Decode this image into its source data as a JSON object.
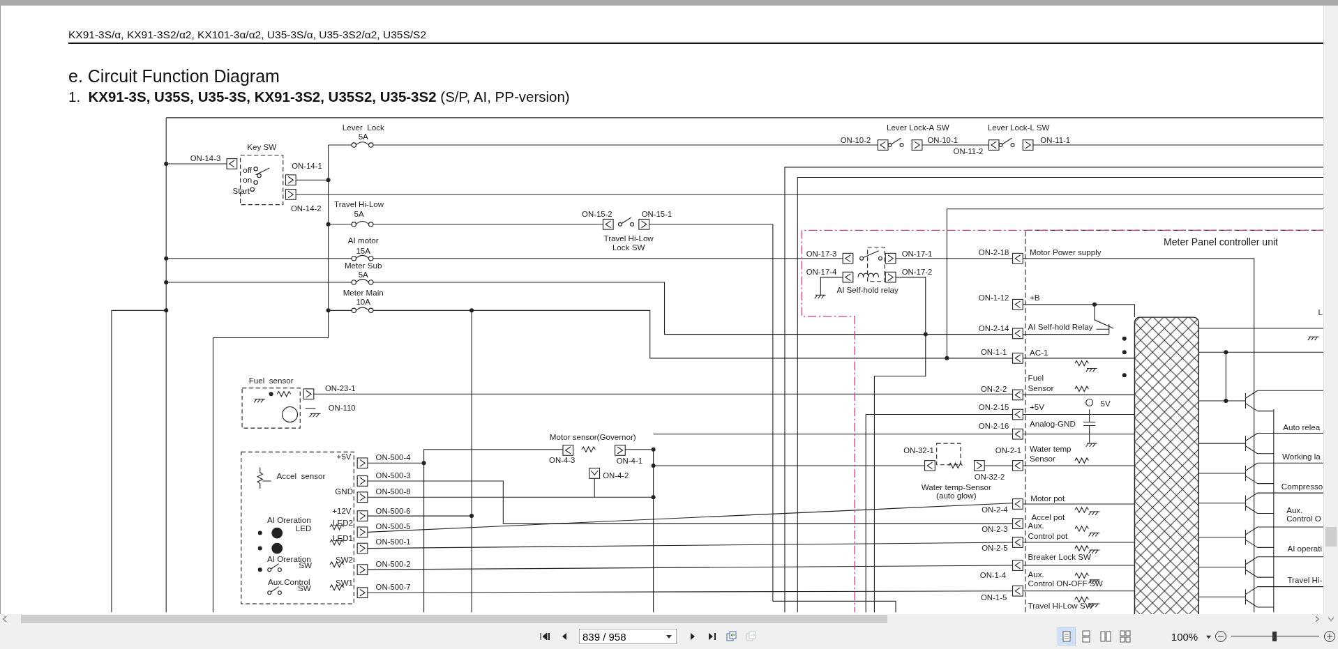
{
  "document": {
    "running_header": "KX91-3S/α, KX91-3S2/α2, KX101-3α/α2, U35-3S/α, U35-3S2/α2, U35S/S2",
    "section_title": "e. Circuit Function Diagram",
    "subtitle": "1.  **KX91-3S, U35S, U35-3S, KX91-3S2, U35S2, U35-3S2** (S/P, AI, PP-version)",
    "diagram": {
      "labels": [
        {
          "text": "Lever  Lock",
          "kind": "fuse"
        },
        {
          "text": "5A",
          "kind": "fuse"
        },
        {
          "text": "Key SW",
          "kind": "component"
        },
        {
          "text": "ON-14-3",
          "kind": "connector"
        },
        {
          "text": "off",
          "kind": "signal"
        },
        {
          "text": "on",
          "kind": "signal"
        },
        {
          "text": "Start",
          "kind": "signal"
        },
        {
          "text": "ON-14-1",
          "kind": "connector"
        },
        {
          "text": "ON-14-2",
          "kind": "connector"
        },
        {
          "text": "Travel Hi-Low",
          "kind": "fuse"
        },
        {
          "text": "5A",
          "kind": "fuse"
        },
        {
          "text": "AI motor",
          "kind": "fuse"
        },
        {
          "text": "15A",
          "kind": "fuse"
        },
        {
          "text": "Meter Sub",
          "kind": "fuse"
        },
        {
          "text": "5A",
          "kind": "fuse"
        },
        {
          "text": "Meter Main",
          "kind": "fuse"
        },
        {
          "text": "10A",
          "kind": "fuse"
        },
        {
          "text": "ON-15-2",
          "kind": "connector"
        },
        {
          "text": "ON-15-1",
          "kind": "connector"
        },
        {
          "text": "Travel Hi-Low",
          "kind": "component"
        },
        {
          "text": "Lock SW",
          "kind": "component"
        },
        {
          "text": "Lever Lock-A SW",
          "kind": "component"
        },
        {
          "text": "ON-10-2",
          "kind": "connector"
        },
        {
          "text": "ON-10-1",
          "kind": "connector"
        },
        {
          "text": "Lever Lock-L SW",
          "kind": "component"
        },
        {
          "text": "ON-11-2",
          "kind": "connector"
        },
        {
          "text": "ON-11-1",
          "kind": "connector"
        },
        {
          "text": "ON-17-3",
          "kind": "connector"
        },
        {
          "text": "ON-17-4",
          "kind": "connector"
        },
        {
          "text": "ON-17-1",
          "kind": "connector"
        },
        {
          "text": "ON-17-2",
          "kind": "connector"
        },
        {
          "text": "AI Self-hold relay",
          "kind": "component"
        },
        {
          "text": "Meter Panel controller unit",
          "kind": "unit"
        },
        {
          "text": "ON-2-18",
          "kind": "connector"
        },
        {
          "text": "Motor Power supply",
          "kind": "signal"
        },
        {
          "text": "ON-1-12",
          "kind": "connector"
        },
        {
          "text": "+B",
          "kind": "signal"
        },
        {
          "text": "ON-2-14",
          "kind": "connector"
        },
        {
          "text": "AI Self-hold Relay",
          "kind": "signal"
        },
        {
          "text": "ON-1-1",
          "kind": "connector"
        },
        {
          "text": "AC-1",
          "kind": "signal"
        },
        {
          "text": "Fuel",
          "kind": "signal"
        },
        {
          "text": "ON-2-2",
          "kind": "connector"
        },
        {
          "text": "Sensor",
          "kind": "signal"
        },
        {
          "text": "ON-2-15",
          "kind": "connector"
        },
        {
          "text": "+5V",
          "kind": "signal"
        },
        {
          "text": "5V",
          "kind": "signal"
        },
        {
          "text": "ON-2-16",
          "kind": "connector"
        },
        {
          "text": "Analog-GND",
          "kind": "signal"
        },
        {
          "text": "ON-32-1",
          "kind": "connector"
        },
        {
          "text": "ON-2-1",
          "kind": "connector"
        },
        {
          "text": "Water temp",
          "kind": "signal"
        },
        {
          "text": "Sensor",
          "kind": "signal"
        },
        {
          "text": "ON-32-2",
          "kind": "connector"
        },
        {
          "text": "Water temp-Sensor",
          "kind": "component"
        },
        {
          "text": "(auto glow)",
          "kind": "component"
        },
        {
          "text": "Motor pot",
          "kind": "signal"
        },
        {
          "text": "ON-2-4",
          "kind": "connector"
        },
        {
          "text": "Accel pot",
          "kind": "signal"
        },
        {
          "text": "Aux.",
          "kind": "signal"
        },
        {
          "text": "Control pot",
          "kind": "signal"
        },
        {
          "text": "ON-2-3",
          "kind": "connector"
        },
        {
          "text": "ON-2-5",
          "kind": "connector"
        },
        {
          "text": "Breaker Lock SW",
          "kind": "signal"
        },
        {
          "text": "ON-1-4",
          "kind": "connector"
        },
        {
          "text": "Aux.",
          "kind": "signal"
        },
        {
          "text": "Control ON-OFF SW",
          "kind": "signal"
        },
        {
          "text": "ON-1-5",
          "kind": "connector"
        },
        {
          "text": "Travel Hi-Low SW",
          "kind": "signal"
        },
        {
          "text": "L",
          "kind": "signal"
        },
        {
          "text": "Auto relea",
          "kind": "signal"
        },
        {
          "text": "Working la",
          "kind": "signal"
        },
        {
          "text": "Compresso",
          "kind": "signal"
        },
        {
          "text": "Aux.",
          "kind": "signal"
        },
        {
          "text": "Control O",
          "kind": "signal"
        },
        {
          "text": "AI operati",
          "kind": "signal"
        },
        {
          "text": "Travel Hi-",
          "kind": "signal"
        },
        {
          "text": "Fuel  sensor",
          "kind": "component"
        },
        {
          "text": "ON-23-1",
          "kind": "connector"
        },
        {
          "text": "ON-110",
          "kind": "connector"
        },
        {
          "text": "+5V",
          "kind": "signal"
        },
        {
          "text": "ON-500-4",
          "kind": "connector"
        },
        {
          "text": "Accel  sensor",
          "kind": "component"
        },
        {
          "text": "ON-500-3",
          "kind": "connector"
        },
        {
          "text": "GND",
          "kind": "signal"
        },
        {
          "text": "ON-500-8",
          "kind": "connector"
        },
        {
          "text": "+12V",
          "kind": "signal"
        },
        {
          "text": "ON-500-6",
          "kind": "connector"
        },
        {
          "text": "AI Oreration",
          "kind": "component"
        },
        {
          "text": "LED",
          "kind": "component"
        },
        {
          "text": "LED2",
          "kind": "signal"
        },
        {
          "text": "ON-500-5",
          "kind": "connector"
        },
        {
          "text": "LED1",
          "kind": "signal"
        },
        {
          "text": "ON-500-1",
          "kind": "connector"
        },
        {
          "text": "AI Oreration",
          "kind": "component"
        },
        {
          "text": "SW",
          "kind": "component"
        },
        {
          "text": "SW2",
          "kind": "signal"
        },
        {
          "text": "ON-500-2",
          "kind": "connector"
        },
        {
          "text": "Aux.Control",
          "kind": "component"
        },
        {
          "text": "SW",
          "kind": "component"
        },
        {
          "text": "SW1",
          "kind": "signal"
        },
        {
          "text": "ON-500-7",
          "kind": "connector"
        },
        {
          "text": "Motor sensor(Governor)",
          "kind": "component"
        },
        {
          "text": "ON-4-3",
          "kind": "connector"
        },
        {
          "text": "ON-4-1",
          "kind": "connector"
        },
        {
          "text": "ON-4-2",
          "kind": "connector"
        }
      ]
    }
  },
  "toolbar": {
    "nav_buttons": [
      {
        "kind": "first",
        "disabled": false
      },
      {
        "kind": "previous",
        "disabled": false
      }
    ],
    "page_field": "839 / 958",
    "nav_buttons_after": [
      {
        "kind": "next",
        "disabled": false
      },
      {
        "kind": "last",
        "disabled": false
      },
      {
        "kind": "back",
        "disabled": false
      },
      {
        "kind": "forward",
        "disabled": true
      }
    ],
    "view_modes": [
      {
        "kind": "single",
        "selected": true
      },
      {
        "kind": "continuous",
        "selected": false
      },
      {
        "kind": "facing",
        "selected": false
      },
      {
        "kind": "facing-continuous",
        "selected": false
      }
    ],
    "zoom_value": "100%",
    "zoom_slider": {
      "level": 0.49
    }
  }
}
